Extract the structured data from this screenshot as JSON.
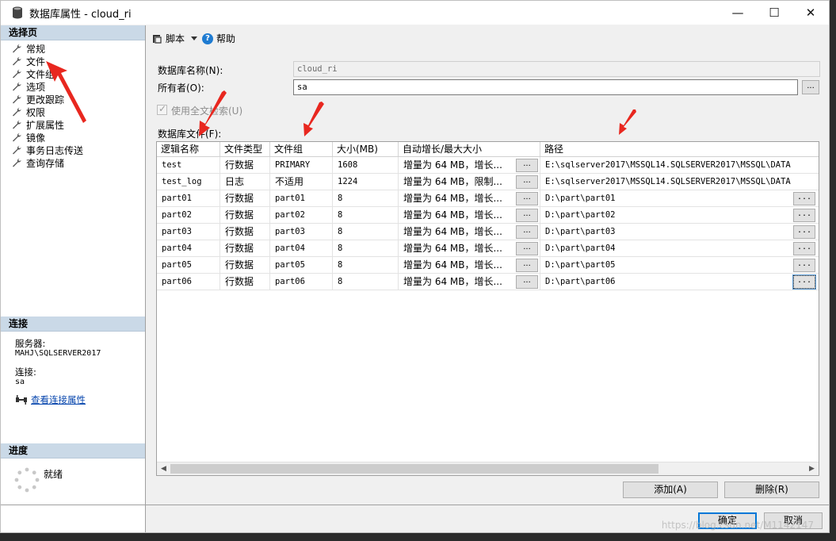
{
  "window": {
    "title": "数据库属性 - cloud_ri",
    "minimize": "—",
    "maximize": "☐",
    "close": "✕"
  },
  "sidebar": {
    "select_page_title": "选择页",
    "items": [
      {
        "label": "常规"
      },
      {
        "label": "文件"
      },
      {
        "label": "文件组"
      },
      {
        "label": "选项"
      },
      {
        "label": "更改跟踪"
      },
      {
        "label": "权限"
      },
      {
        "label": "扩展属性"
      },
      {
        "label": "镜像"
      },
      {
        "label": "事务日志传送"
      },
      {
        "label": "查询存储"
      }
    ],
    "connection": {
      "title": "连接",
      "server_label": "服务器:",
      "server_value": "MAHJ\\SQLSERVER2017",
      "connection_label": "连接:",
      "connection_value": "sa",
      "view_link": "查看连接属性"
    },
    "progress": {
      "title": "进度",
      "status": "就绪"
    }
  },
  "toolbar": {
    "script_label": "脚本",
    "help_label": "帮助"
  },
  "form": {
    "db_name_label": "数据库名称(N):",
    "db_name_value": "cloud_ri",
    "owner_label": "所有者(O):",
    "owner_value": "sa",
    "browse_label": "...",
    "fulltext_label": "使用全文检索(U)",
    "db_files_label": "数据库文件(F):"
  },
  "grid": {
    "columns": [
      "逻辑名称",
      "文件类型",
      "文件组",
      "大小(MB)",
      "自动增长/最大大小",
      "路径"
    ],
    "rows": [
      {
        "name": "test",
        "type": "行数据",
        "group": "PRIMARY",
        "size": "1608",
        "growth": "增量为 64 MB，增长...",
        "path": "E:\\sqlserver2017\\MSSQL14.SQLSERVER2017\\MSSQL\\DATA",
        "path_btn": false
      },
      {
        "name": "test_log",
        "type": "日志",
        "group": "不适用",
        "size": "1224",
        "growth": "增量为 64 MB，限制...",
        "path": "E:\\sqlserver2017\\MSSQL14.SQLSERVER2017\\MSSQL\\DATA",
        "path_btn": false
      },
      {
        "name": "part01",
        "type": "行数据",
        "group": "part01",
        "size": "8",
        "growth": "增量为 64 MB，增长...",
        "path": "D:\\part\\part01",
        "path_btn": true
      },
      {
        "name": "part02",
        "type": "行数据",
        "group": "part02",
        "size": "8",
        "growth": "增量为 64 MB，增长...",
        "path": "D:\\part\\part02",
        "path_btn": true
      },
      {
        "name": "part03",
        "type": "行数据",
        "group": "part03",
        "size": "8",
        "growth": "增量为 64 MB，增长...",
        "path": "D:\\part\\part03",
        "path_btn": true
      },
      {
        "name": "part04",
        "type": "行数据",
        "group": "part04",
        "size": "8",
        "growth": "增量为 64 MB，增长...",
        "path": "D:\\part\\part04",
        "path_btn": true
      },
      {
        "name": "part05",
        "type": "行数据",
        "group": "part05",
        "size": "8",
        "growth": "增量为 64 MB，增长...",
        "path": "D:\\part\\part05",
        "path_btn": true
      },
      {
        "name": "part06",
        "type": "行数据",
        "group": "part06",
        "size": "8",
        "growth": "增量为 64 MB，增长...",
        "path": "D:\\part\\part06",
        "path_btn": true
      }
    ],
    "ellipsis": "..."
  },
  "actions": {
    "add": "添加(A)",
    "remove": "删除(R)",
    "ok": "确定",
    "cancel": "取消"
  },
  "watermark": "https://blog.csdn.net/M1142147",
  "colors": {
    "pane_header": "#cad9e7",
    "accent": "#0078d7",
    "annotation_arrow": "#e8271f"
  }
}
